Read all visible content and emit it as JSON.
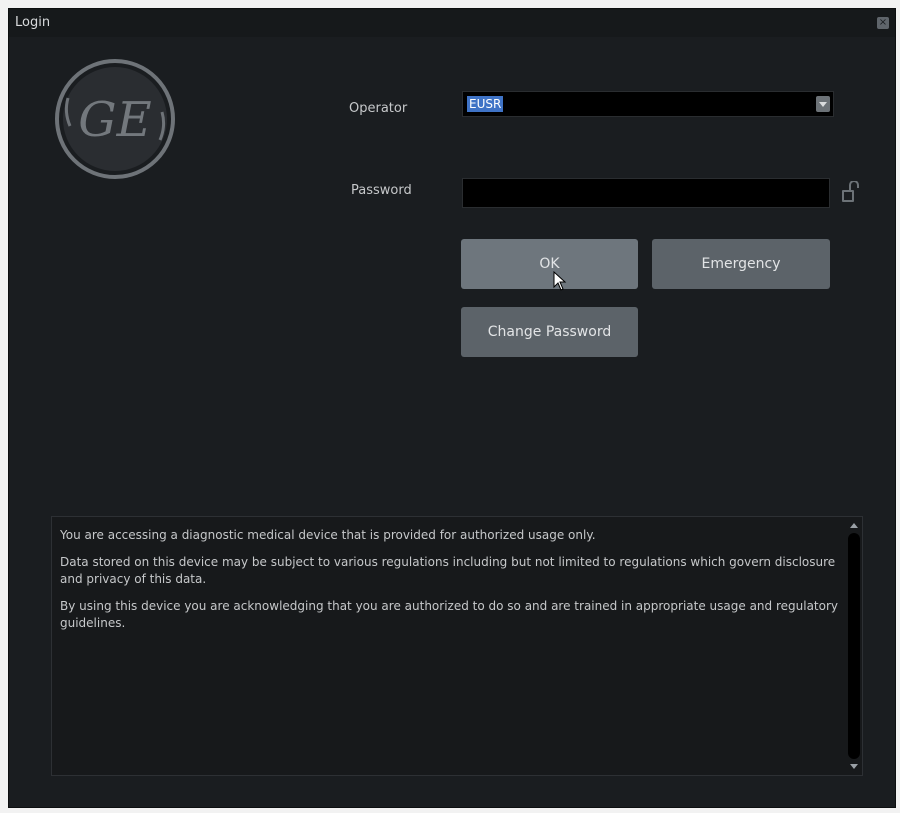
{
  "window": {
    "title": "Login",
    "close_label": "×"
  },
  "form": {
    "operator_label": "Operator",
    "operator_value": "EUSR",
    "password_label": "Password",
    "password_value": ""
  },
  "buttons": {
    "ok_label": "OK",
    "emergency_label": "Emergency",
    "change_password_label": "Change Password"
  },
  "notice": {
    "paragraphs": [
      "You are accessing a diagnostic medical device that is provided for authorized usage only.",
      "Data stored on this device may be subject to various regulations including but not limited to regulations which govern disclosure and privacy of this data.",
      "By using this device you are acknowledging that you are authorized to do so and are trained in appropriate usage and regulatory guidelines."
    ]
  },
  "logo": {
    "text": "GE",
    "icon": "ge-logo-icon"
  },
  "colors": {
    "background": "#1a1d20",
    "button": "#5c6369",
    "selection": "#3f73c6"
  }
}
